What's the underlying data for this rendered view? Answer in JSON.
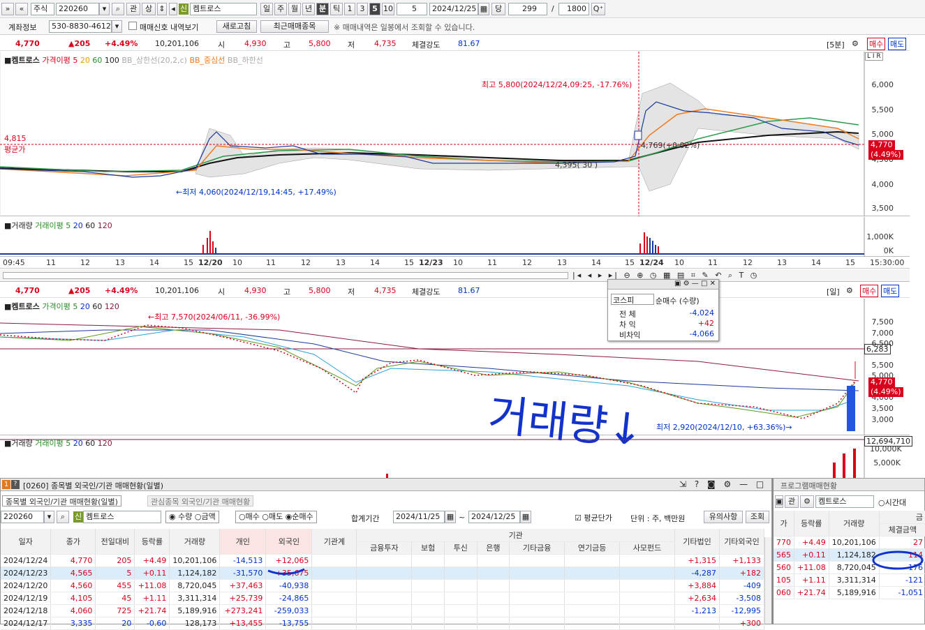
{
  "toolbar": {
    "market": "주식",
    "code": "220260",
    "btn_gwan": "관",
    "btn_sang": "상",
    "sin": "신",
    "name": "켐트로스",
    "periods": [
      "일",
      "주",
      "월",
      "년",
      "분",
      "틱"
    ],
    "period_selected": "분",
    "minutes": [
      "1",
      "3",
      "5",
      "10"
    ],
    "minute_selected": "5",
    "minute_value": "5",
    "date": "2024/12/25",
    "dang": "당",
    "count": "299",
    "total": "1800"
  },
  "account": {
    "label": "계좌정보",
    "number": "530-8830-4612-",
    "signal_label": "매매신호 내역보기",
    "refresh": "새로고침",
    "recent": "최근매매종목",
    "notice": "※ 매매내역은 일봉에서 조회할 수 있습니다."
  },
  "price": {
    "close": "4,770",
    "change": "▲205",
    "rate": "+4.49%",
    "volume": "10,201,106",
    "open_label": "시",
    "open": "4,930",
    "high_label": "고",
    "high": "5,800",
    "low_label": "저",
    "low": "4,735",
    "strength_label": "체결강도",
    "strength": "81.67"
  },
  "chart1": {
    "period_tag": "[5분]",
    "buy": "매수",
    "sell": "매도",
    "legend_name": "켐트로스",
    "legend_ma": "가격이평",
    "ma": [
      "5",
      "20",
      "60",
      "100"
    ],
    "bb_upper": "BB_상한선(20,2,c)",
    "bb_mid": "BB_중심선",
    "bb_lower": "BB_하한선",
    "avg_price": "4,815",
    "avg_label": "평균가",
    "high_note": "최고 5,800(2024/12/24,09:25, -17.76%)",
    "low_note": "←최저 4,060(2024/12/19,14:45, +17.49%)",
    "mid_note": "4,769(+0.02%)",
    "mid_note2": "4,395( 30 )",
    "yticks": [
      "6,000",
      "5,500",
      "5,000",
      "4,500",
      "4,000",
      "3,500"
    ],
    "price_tag": "4,770",
    "rate_tag": "(4.49%)",
    "lir": "L I R"
  },
  "vol1": {
    "label": "거래량",
    "ma_label": "거래이평",
    "ma": [
      "5",
      "20",
      "60",
      "120"
    ],
    "yticks": [
      "1,000K",
      "0K"
    ]
  },
  "xaxis1": [
    "09:45",
    "11",
    "12",
    "13",
    "14",
    "15",
    "12/20",
    "10",
    "11",
    "12",
    "13",
    "14",
    "15",
    "12/23",
    "10",
    "11",
    "12",
    "13",
    "14",
    "15",
    "12/24",
    "10",
    "11",
    "12",
    "13",
    "14",
    "15",
    "15:30:00"
  ],
  "chart2": {
    "period_tag": "[일]",
    "buy": "매수",
    "sell": "매도",
    "legend_name": "켐트로스",
    "legend_ma": "가격이평",
    "ma": [
      "5",
      "20",
      "60",
      "120"
    ],
    "high_note": "←최고 7,570(2024/06/11, -36.99%)",
    "low_note": "최저 2,920(2024/12/10, +63.36%)→",
    "line_tag": "6,283",
    "price_tag": "4,770",
    "rate_tag": "(4.49%)",
    "yticks": [
      "7,500",
      "7,000",
      "6,500",
      "6,000",
      "5,500",
      "5,000",
      "4,500",
      "4,000",
      "3,500",
      "3,000"
    ]
  },
  "popup": {
    "market": "코스피",
    "col": "순매수 (수량)",
    "rows": [
      {
        "k": "전 체",
        "v": "-4,024"
      },
      {
        "k": "차 익",
        "v": "+42"
      },
      {
        "k": "비차익",
        "v": "-4,066"
      }
    ]
  },
  "vol2": {
    "label": "거래량",
    "ma_label": "거래이평",
    "ma": [
      "5",
      "20",
      "60",
      "120"
    ],
    "tag": "12,694,710",
    "yticks": [
      "10,000K",
      "5,000K"
    ]
  },
  "handwriting": "거래량↓",
  "win": {
    "num": "1",
    "title": "[0260] 종목별 외국인/기관 매매현황(일별)",
    "tab1": "종목별 외국인/기관 매매현황(일별)",
    "tab2": "관심종목 외국인/기관 매매현황",
    "code": "220260",
    "sin": "신",
    "name": "켐트로스",
    "radio1": [
      "수량",
      "금액"
    ],
    "radio2": [
      "매수",
      "매도",
      "순매수"
    ],
    "period_label": "합계기간",
    "from": "2024/11/25",
    "to": "2024/12/25",
    "avg_label": "평균단가",
    "unit": "단위 : 주, 백만원",
    "btn1": "유의사항",
    "btn2": "조회"
  },
  "table": {
    "headers": [
      "일자",
      "종가",
      "전일대비",
      "등락률",
      "거래량",
      "개인",
      "외국인",
      "기관계"
    ],
    "inst_header": "기관",
    "inst_cols": [
      "금융투자",
      "보험",
      "투신",
      "은행",
      "기타금융",
      "연기금등",
      "사모펀드"
    ],
    "tail": [
      "기타법인",
      "기타외국인"
    ],
    "rows": [
      {
        "d": "2024/12/24",
        "c": "4,770",
        "ch": "205",
        "r": "+4.49",
        "v": "10,201,106",
        "p": "-14,513",
        "f": "+12,065",
        "o": "+1,315",
        "of": "+1,133"
      },
      {
        "d": "2024/12/23",
        "c": "4,565",
        "ch": "5",
        "r": "+0.11",
        "v": "1,124,182",
        "p": "-31,570",
        "f": "+35,675",
        "o": "-4,287",
        "of": "+182"
      },
      {
        "d": "2024/12/20",
        "c": "4,560",
        "ch": "455",
        "r": "+11.08",
        "v": "8,720,045",
        "p": "+37,463",
        "f": "-40,938",
        "o": "+3,884",
        "of": "-409"
      },
      {
        "d": "2024/12/19",
        "c": "4,105",
        "ch": "45",
        "r": "+1.11",
        "v": "3,311,314",
        "p": "+25,739",
        "f": "-24,865",
        "o": "+2,634",
        "of": "-3,508"
      },
      {
        "d": "2024/12/18",
        "c": "4,060",
        "ch": "725",
        "r": "+21.74",
        "v": "5,189,916",
        "p": "+273,241",
        "f": "-259,033",
        "o": "-1,213",
        "of": "-12,995"
      },
      {
        "d": "2024/12/17",
        "c": "3,335",
        "ch": "20",
        "r": "-0.60",
        "v": "128,173",
        "p": "+13,455",
        "f": "-13,755",
        "o": "",
        "of": "+300"
      }
    ]
  },
  "prog": {
    "title": "프로그램매매현황",
    "gwan": "관",
    "name": "켐트로스",
    "radio": "시간대",
    "headers": [
      "가",
      "등락률",
      "거래량",
      "체결금액"
    ],
    "hdr_extra": "금",
    "rows": [
      {
        "a": "770",
        "r": "+4.49",
        "v": "10,201,106",
        "e": "27"
      },
      {
        "a": "565",
        "r": "+0.11",
        "v": "1,124,182",
        "e": "114"
      },
      {
        "a": "560",
        "r": "+11.08",
        "v": "8,720,045",
        "e": "-176"
      },
      {
        "a": "105",
        "r": "+1.11",
        "v": "3,311,314",
        "e": "-121"
      },
      {
        "a": "060",
        "r": "+21.74",
        "v": "5,189,916",
        "e": "-1,051"
      }
    ]
  }
}
